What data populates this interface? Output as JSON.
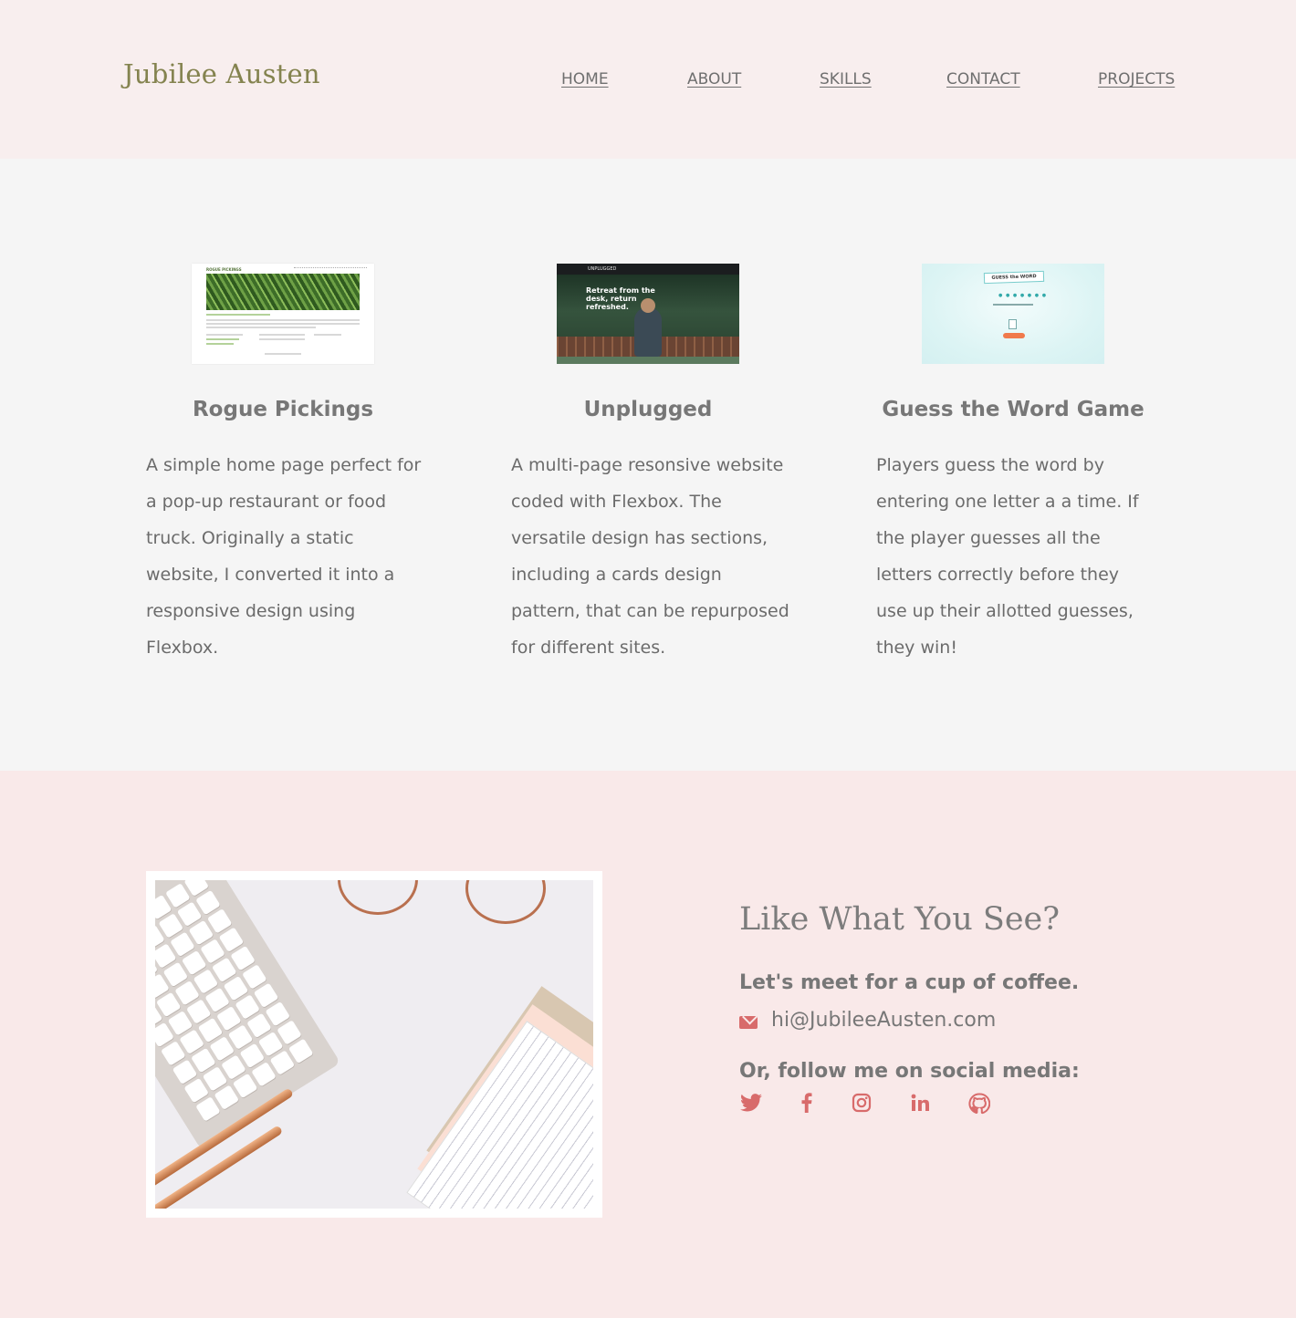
{
  "header": {
    "logo": "Jubilee Austen",
    "nav": [
      "HOME",
      "ABOUT",
      "SKILLS",
      "CONTACT",
      "PROJECTS"
    ]
  },
  "projects": [
    {
      "title": "Rogue Pickings",
      "description": "A simple home page perfect for a pop-up restaurant or food truck. Originally a static website, I converted it into a responsive design using Flexbox.",
      "thumb_brand": "ROGUE PICKINGS"
    },
    {
      "title": "Unplugged",
      "description": "A multi-page resonsive website coded with Flexbox. The versatile design has sections, including a cards design pattern, that can be repurposed for different sites.",
      "thumb_brand": "UNPLUGGED",
      "thumb_tagline": "Retreat from the desk, return refreshed."
    },
    {
      "title": "Guess the Word Game",
      "description": "Players guess the word by entering one letter a a time. If the player guesses all the letters correctly before they use up their allotted guesses, they win!",
      "thumb_label": "GUESS the WORD"
    }
  ],
  "contact": {
    "title": "Like What You See?",
    "subtitle": "Let's meet for a cup of coffee.",
    "email": "hi@JubileeAusten.com",
    "follow": "Or, follow me on social media:",
    "social": [
      "twitter-icon",
      "facebook-icon",
      "instagram-icon",
      "linkedin-icon",
      "github-icon"
    ]
  },
  "colors": {
    "header_bg": "#f8eeee",
    "logo": "#84834f",
    "section_bg": "#f5f5f5",
    "contact_bg": "#f9e9e9",
    "accent": "#d86b6b"
  }
}
